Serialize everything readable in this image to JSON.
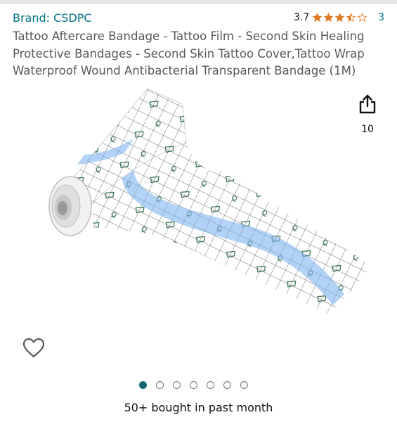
{
  "brand": {
    "label": "Brand: CSDPC"
  },
  "rating": {
    "value": "3.7",
    "stars_filled": 3.7,
    "stars_total": 5,
    "count": "3",
    "star_color": "#de7921"
  },
  "title": "Tattoo Aftercare Bandage - Tattoo Film - Second Skin Healing Protective Bandages - Second Skin Tattoo Cover,Tattoo Wrap Waterproof Wound Antibacterial Transparent Bandage (1M)",
  "share": {
    "icon": "share-icon",
    "count": "10"
  },
  "wishlist": {
    "icon": "heart-icon"
  },
  "carousel": {
    "total": 7,
    "active": 1
  },
  "bought": "50+ bought in past month",
  "colors": {
    "link": "#007185",
    "active_dot": "#116571",
    "grid_green": "#2f6b45",
    "stripe_blue": "#7fb6f0"
  }
}
